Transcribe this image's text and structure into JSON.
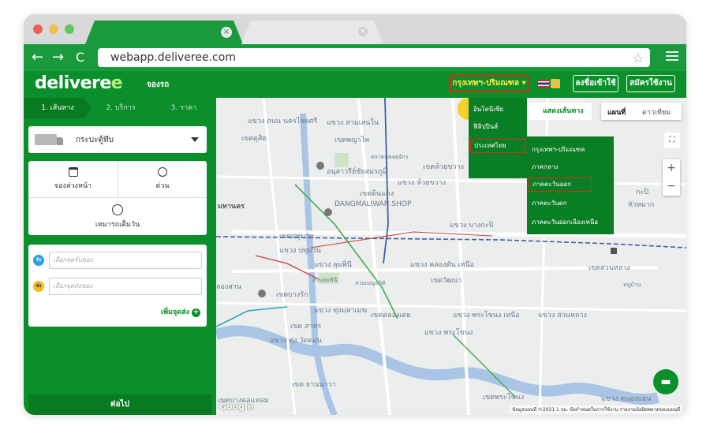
{
  "browser": {
    "url": "webapp.deliveree.com",
    "back": "←",
    "forward": "→",
    "reload": "C",
    "star": "☆",
    "tab_close": "×"
  },
  "header": {
    "logo": "delivere",
    "logo_suffix": "e",
    "booking_link": "จองรถ",
    "region": "กรุงเทพฯ-ปริมณฑล ▾",
    "login": "ลงชื่อเข้าใช้",
    "signup": "สมัครใช้งาน"
  },
  "steps": [
    "1. เส้นทาง",
    "2. บริการ",
    "3. ราคา"
  ],
  "vehicle": {
    "label": "กระบะตู้ทึบ"
  },
  "time_options": {
    "advance": "จองล่วงหน้า",
    "urgent": "ด่วน",
    "full_day": "เหมารถเต็มวัน"
  },
  "route": {
    "pickup_badge": "รับ",
    "pickup_placeholder": "เลือกจุดรับของ",
    "drop_badge": "ส่ง",
    "drop_placeholder": "เลือกจุดส่งของ",
    "add_drop": "เพิ่มจุดส่ง",
    "add_plus": "+"
  },
  "next_button": "ต่อไป",
  "map": {
    "show_route": "แสดงเส้นทาง",
    "map_type": "แผนที่",
    "satellite": "ดาวเทียม",
    "zoom_in": "+",
    "zoom_out": "−",
    "fullscreen": "⛶",
    "google": "Google",
    "attribution": "ข้อมูลแผนที่ ©2021   1 กม.        ข้อกำหนดในการใช้งาน   รายงานข้อผิดพลาดของแผนที่",
    "chat": "▬",
    "labels": [
      "แขวง ถนน นครไชยศรี",
      "แขวง สามเสนใน",
      "เขตดุสิต",
      "เขตพญาไท",
      "เขตห้วยขวาง",
      "แขวง ห้วยขวาง",
      "เขตดินแดง",
      "อนุสาวรีย์ชัยสมรภูมิ",
      "DANGMALIWAN.SHOP",
      "มหานคร",
      "เขตปทุมวัน",
      "แขวง ปทุมวัน",
      "แขวง ลุมพินี",
      "แขวง บางกะปิ",
      "แขวง คลองตัน เหนือ",
      "เขตวัฒนา",
      "เขตบางรัก",
      "แขวง ทุ่งมหาเมฆ",
      "เขตคลองเตย",
      "แขวง พระโขนง เหนือ",
      "แขวง พระโขนง",
      "แขวง สวนหลวง",
      "เขต สาทร",
      "แขวง ทุ่ง วัดดอน",
      "เขต ยานนาวา",
      "เขตพระโขนง",
      "แขวง หนองบอน",
      "เขตบางคอแหลม",
      "สวนลุมพินี",
      "สวนเบญจกิติ",
      "ตลาดนัดจตุจักร",
      "เขตสวนหลวง",
      "หมู่บ้าน",
      "กะปิ",
      "หัวหมาก",
      "ลองสาน"
    ]
  },
  "dropdown": {
    "countries": [
      "อินโดนีเซีย",
      "ฟิลิปปินส์",
      "ประเทศไทย"
    ],
    "regions": [
      "กรุงเทพฯ-ปริมณฑล",
      "ภาคกลาง",
      "ภาคตะวันออก",
      "ภาคตะวันตก",
      "ภาคตะวันออกเฉียงเหนือ"
    ]
  },
  "colors": {
    "brand_green": "#0a8f2a",
    "highlight_red": "#e02a1a",
    "region_text": "#ffea4a"
  }
}
